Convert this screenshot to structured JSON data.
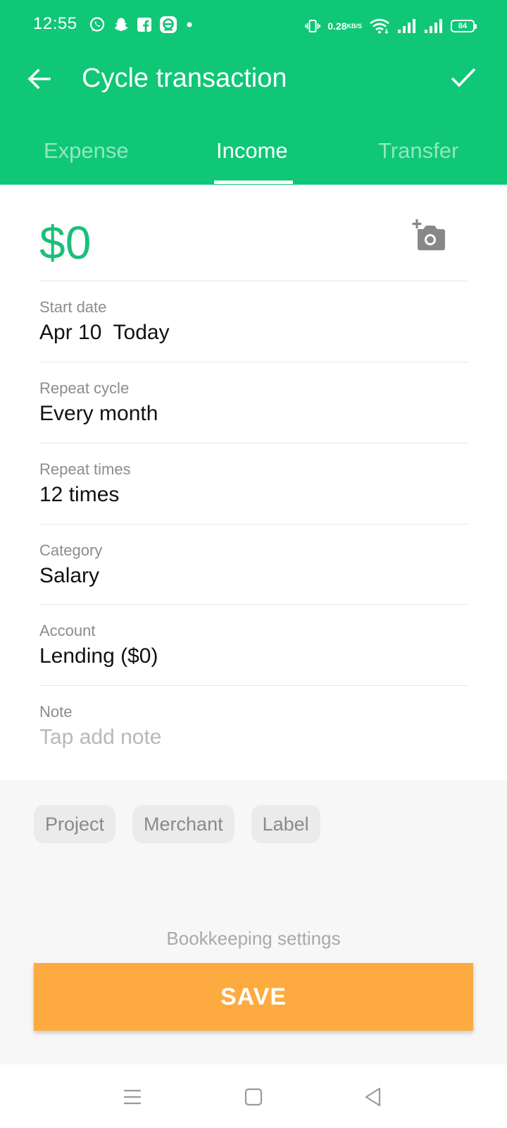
{
  "status_bar": {
    "time": "12:55",
    "notifications": [
      "whatsapp-icon",
      "snapchat-icon",
      "facebook-icon",
      "app-icon",
      "dot-icon"
    ],
    "net_speed_value": "0.28",
    "net_speed_unit": "KB/S",
    "battery": "84"
  },
  "app_bar": {
    "title": "Cycle transaction",
    "back_icon": "arrow-left-icon",
    "confirm_icon": "check-icon"
  },
  "tabs": [
    {
      "label": "Expense",
      "active": false
    },
    {
      "label": "Income",
      "active": true
    },
    {
      "label": "Transfer",
      "active": false
    }
  ],
  "form": {
    "amount": "$0",
    "camera_icon": "add-photo-icon",
    "fields": [
      {
        "label": "Start date",
        "value": "Apr 10  Today"
      },
      {
        "label": "Repeat cycle",
        "value": "Every month"
      },
      {
        "label": "Repeat times",
        "value": "12 times"
      },
      {
        "label": "Category",
        "value": "Salary"
      },
      {
        "label": "Account",
        "value": "Lending ($0)"
      },
      {
        "label": "Note",
        "placeholder": "Tap add note"
      }
    ]
  },
  "chips": [
    "Project",
    "Merchant",
    "Label"
  ],
  "bookkeeping_settings": "Bookkeeping settings",
  "save_label": "SAVE",
  "colors": {
    "primary": "#0fc776",
    "amount": "#1bbf78",
    "save_button": "#fdab40"
  },
  "nav_bar": [
    "menu-icon",
    "home-icon",
    "back-triangle-icon"
  ]
}
